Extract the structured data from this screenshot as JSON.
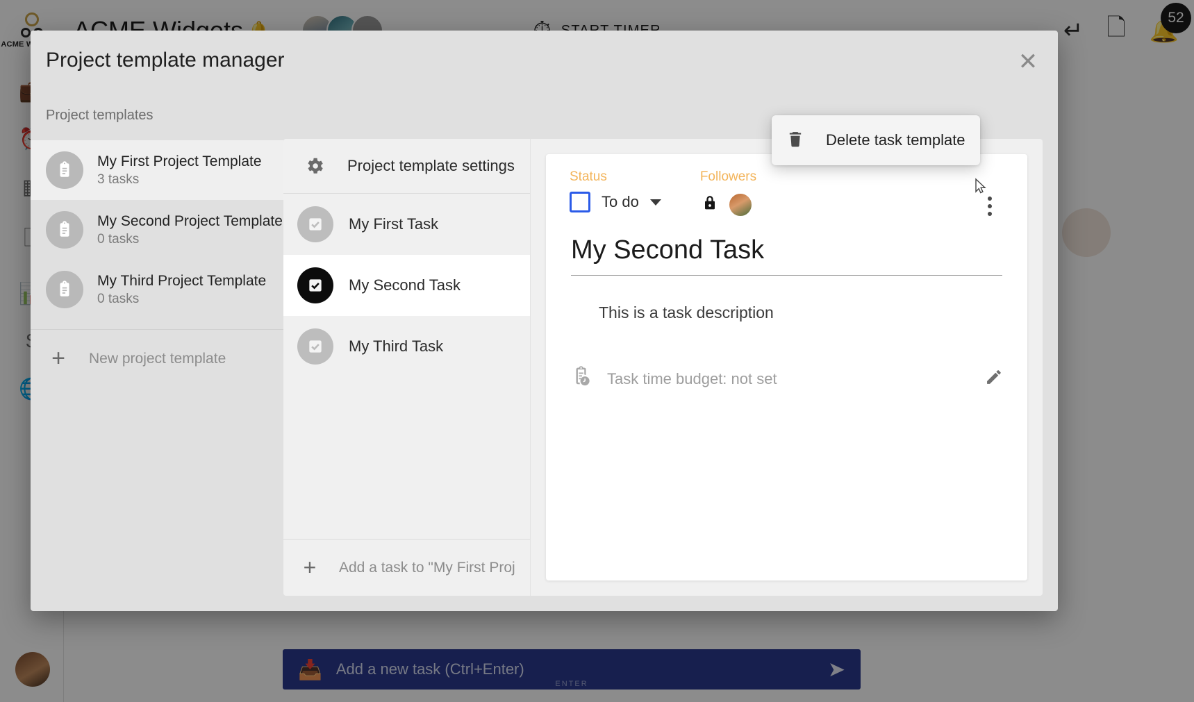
{
  "background_app": {
    "brand_badge": "ACME WIDGETS",
    "title": "ACME Widgets",
    "bell_icon": "bell-icon",
    "avatar_more_label": "...",
    "timer": {
      "icon": "stopwatch-icon",
      "label": "START TIMER"
    },
    "topbar_right": {
      "undo_icon": "undo-arrow-icon",
      "copy_icon": "duplicate-icon",
      "notifications_icon": "bell-icon",
      "notification_count": "52"
    },
    "sidebar_icons": [
      "briefcase-icon",
      "clock-icon",
      "grid-icon",
      "document-icon",
      "chart-icon",
      "dollar-icon",
      "globe-icon"
    ],
    "composer": {
      "icon": "inbox-icon",
      "placeholder": "Add a new task (Ctrl+Enter)",
      "send_icon": "send-icon",
      "sub_label": "ENTER"
    }
  },
  "modal": {
    "title": "Project template manager",
    "close_icon": "close-icon",
    "templates_panel": {
      "heading": "Project templates",
      "items": [
        {
          "name": "My First Project Template",
          "count": "3 tasks",
          "icon": "clipboard-icon",
          "selected": true
        },
        {
          "name": "My Second Project Template",
          "count": "0 tasks",
          "icon": "clipboard-icon",
          "selected": false
        },
        {
          "name": "My Third Project Template",
          "count": "0 tasks",
          "icon": "clipboard-icon",
          "selected": false
        }
      ],
      "new_template_label": "New project template",
      "new_template_icon": "plus-icon"
    },
    "tasks_panel": {
      "settings_label": "Project template settings",
      "settings_icon": "gear-icon",
      "items": [
        {
          "label": "My First Task",
          "active": false
        },
        {
          "label": "My Second Task",
          "active": true
        },
        {
          "label": "My Third Task",
          "active": false
        }
      ],
      "add_task_label": "Add a task to \"My First Proj",
      "add_task_icon": "plus-icon"
    },
    "detail_panel": {
      "status_label": "Status",
      "status_value": "To do",
      "status_checkbox_color": "#2b5be8",
      "meta_label_color": "#f3b45a",
      "followers_label": "Followers",
      "lock_icon": "lock-icon",
      "follower_avatar": "avatar",
      "kebab_icon": "more-vertical-icon",
      "task_title": "My Second Task",
      "task_description": "This is a task description",
      "budget_icon": "clipboard-clock-icon",
      "budget_text": "Task time budget: not set",
      "edit_icon": "pencil-icon"
    },
    "delete_menu": {
      "icon": "trash-x-icon",
      "label": "Delete task template"
    }
  }
}
